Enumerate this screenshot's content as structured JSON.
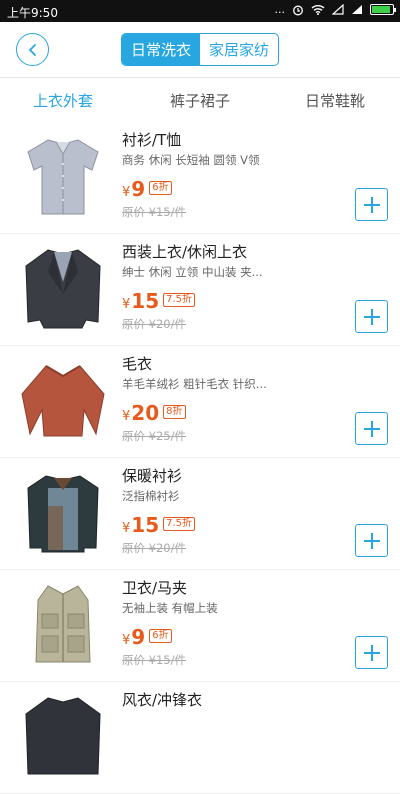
{
  "status_bar": {
    "time": "上午9:50",
    "network": "...",
    "battery_color": "#3fd04a"
  },
  "header": {
    "segments": [
      {
        "label": "日常洗衣",
        "active": true
      },
      {
        "label": "家居家纺",
        "active": false
      }
    ],
    "accent": "#27a6e0"
  },
  "tabs": [
    {
      "label": "上衣外套",
      "active": true
    },
    {
      "label": "裤子裙子",
      "active": false
    },
    {
      "label": "日常鞋靴",
      "active": false
    }
  ],
  "items": [
    {
      "name": "衬衫/T恤",
      "tags": "商务 休闲 长短袖 圆领 V领",
      "currency": "¥",
      "price": "9",
      "discount": "6折",
      "original": "原价 ¥15/件",
      "icon": "shirt"
    },
    {
      "name": "西装上衣/休闲上衣",
      "tags": "绅士 休闲 立领 中山装 夹...",
      "currency": "¥",
      "price": "15",
      "discount": "7.5折",
      "original": "原价 ¥20/件",
      "icon": "blazer"
    },
    {
      "name": "毛衣",
      "tags": "羊毛羊绒衫 粗针毛衣 针织...",
      "currency": "¥",
      "price": "20",
      "discount": "8折",
      "original": "原价 ¥25/件",
      "icon": "sweater"
    },
    {
      "name": "保暖衬衫",
      "tags": "泛指棉衬衫",
      "currency": "¥",
      "price": "15",
      "discount": "7.5折",
      "original": "原价 ¥20/件",
      "icon": "warm-shirt"
    },
    {
      "name": "卫衣/马夹",
      "tags": "无袖上装 有帽上装",
      "currency": "¥",
      "price": "9",
      "discount": "6折",
      "original": "原价 ¥15/件",
      "icon": "vest"
    },
    {
      "name": "风衣/冲锋衣",
      "tags": "",
      "currency": "",
      "price": "",
      "discount": "",
      "original": "",
      "icon": "jacket"
    }
  ],
  "colors": {
    "accent": "#27a6e0",
    "price": "#e85a1b"
  }
}
